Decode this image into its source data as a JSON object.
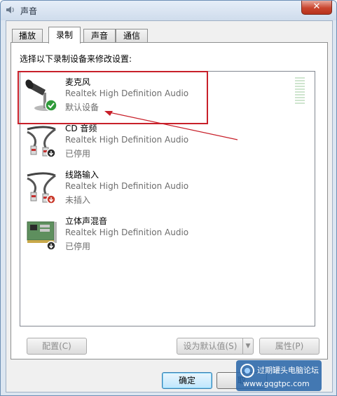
{
  "window": {
    "title": "声音",
    "close_label": "✕"
  },
  "tabs": [
    {
      "label": "播放",
      "active": false
    },
    {
      "label": "录制",
      "active": true
    },
    {
      "label": "声音",
      "active": false
    },
    {
      "label": "通信",
      "active": false
    }
  ],
  "panel": {
    "instruction": "选择以下录制设备来修改设置:"
  },
  "devices": [
    {
      "name": "麦克风",
      "driver": "Realtek High Definition Audio",
      "status": "默认设备",
      "icon": "microphone-icon",
      "badge": "default-check-icon"
    },
    {
      "name": "CD 音频",
      "driver": "Realtek High Definition Audio",
      "status": "已停用",
      "icon": "audio-cable-icon",
      "badge": "disabled-down-icon"
    },
    {
      "name": "线路输入",
      "driver": "Realtek High Definition Audio",
      "status": "未插入",
      "icon": "audio-cable-icon",
      "badge": "unplugged-red-icon"
    },
    {
      "name": "立体声混音",
      "driver": "Realtek High Definition Audio",
      "status": "已停用",
      "icon": "sound-card-icon",
      "badge": "disabled-down-icon"
    }
  ],
  "buttons": {
    "configure": "配置(C)",
    "set_default": "设为默认值(S)",
    "properties": "属性(P)",
    "ok": "确定",
    "cancel": "取"
  },
  "watermark": {
    "title": "过期罐头电脑论坛",
    "url": "www.gqgtpc.com"
  },
  "colors": {
    "highlight": "#c8202a",
    "window_frame": "#dce6f1",
    "default_button": "#bee6fd"
  }
}
